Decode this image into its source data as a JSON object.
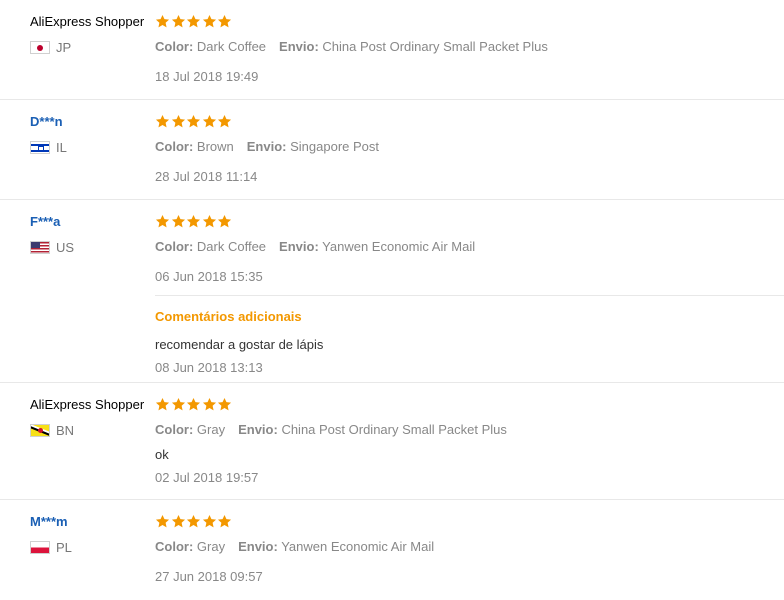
{
  "labels": {
    "color": "Color:",
    "shipping": "Envio:"
  },
  "colors": {
    "star": "#f39800",
    "link": "#1a5fb4"
  },
  "reviews": [
    {
      "user": "AliExpress Shopper",
      "country": "JP",
      "flag": "japan-flag",
      "rating": 5,
      "color": "Dark Coffee",
      "shipping": "China Post Ordinary Small Packet Plus",
      "date": "18 Jul 2018 19:49"
    },
    {
      "user": "D***n",
      "country": "IL",
      "flag": "israel-flag",
      "rating": 5,
      "color": "Brown",
      "shipping": "Singapore Post",
      "date": "28 Jul 2018 11:14"
    },
    {
      "user": "F***a",
      "country": "US",
      "flag": "usa-flag",
      "rating": 5,
      "color": "Dark Coffee",
      "shipping": "Yanwen Economic Air Mail",
      "date": "06 Jun 2018 15:35",
      "additional": {
        "title": "Comentários adicionais",
        "text": "recomendar a gostar de lápis",
        "date": "08 Jun 2018 13:13"
      }
    },
    {
      "user": "AliExpress Shopper",
      "country": "BN",
      "flag": "brunei-flag",
      "rating": 5,
      "color": "Gray",
      "shipping": "China Post Ordinary Small Packet Plus",
      "text": "ok",
      "date": "02 Jul 2018 19:57"
    },
    {
      "user": "M***m",
      "country": "PL",
      "flag": "poland-flag",
      "rating": 5,
      "color": "Gray",
      "shipping": "Yanwen Economic Air Mail",
      "date": "27 Jun 2018 09:57"
    }
  ]
}
